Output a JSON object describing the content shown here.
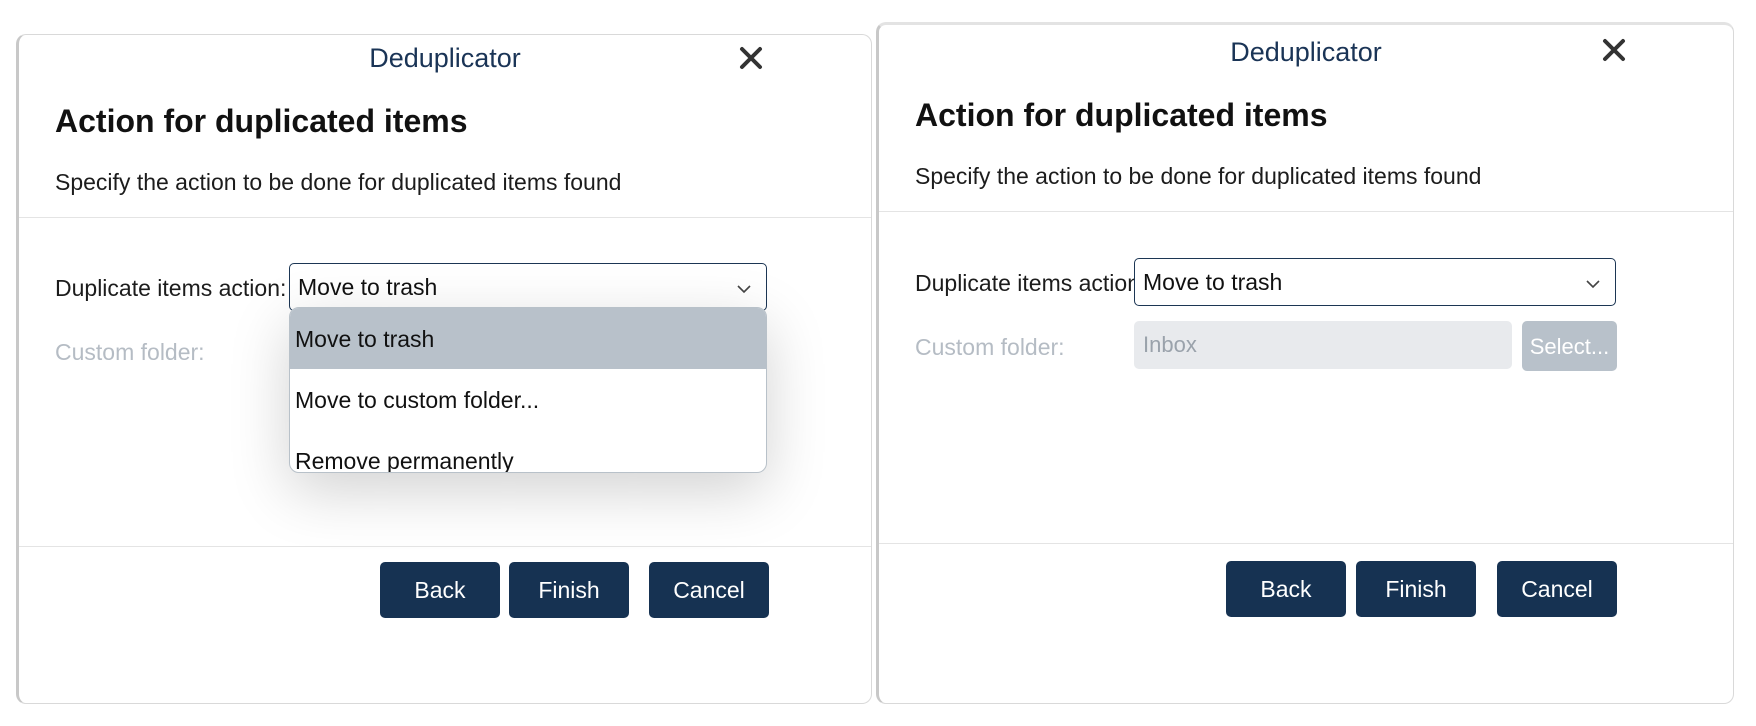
{
  "left_dialog": {
    "app_title": "Deduplicator",
    "heading": "Action for duplicated items",
    "subtitle": "Specify the action to be done for duplicated items found",
    "action_label": "Duplicate items action:",
    "action_value": "Move to trash",
    "custom_folder_label": "Custom folder:",
    "dropdown_options": [
      "Move to trash",
      "Move to custom folder...",
      "Remove permanently"
    ],
    "selected_option": "Move to trash",
    "buttons": {
      "back": "Back",
      "finish": "Finish",
      "cancel": "Cancel"
    }
  },
  "right_dialog": {
    "app_title": "Deduplicator",
    "heading": "Action for duplicated items",
    "subtitle": "Specify the action to be done for duplicated items found",
    "action_label": "Duplicate items action:",
    "action_value": "Move to trash",
    "custom_folder_label": "Custom folder:",
    "custom_folder_value": "Inbox",
    "select_button": "Select...",
    "buttons": {
      "back": "Back",
      "finish": "Finish",
      "cancel": "Cancel"
    }
  },
  "colors": {
    "title": "#1a3456",
    "primary_button": "#163252",
    "selected_option": "#b8c1ca",
    "disabled_text": "#b5bcc4"
  },
  "icons": {
    "close": "close-icon",
    "dropdown": "chevron-down-icon"
  }
}
